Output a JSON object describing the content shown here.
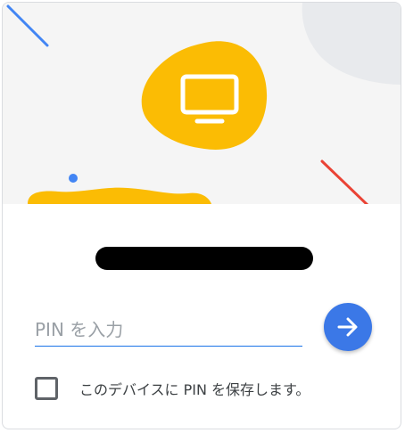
{
  "illustration": {
    "icon": "monitor-icon",
    "colors": {
      "background": "#f5f5f5",
      "blob": "#fbbc04",
      "corner_shape": "#e8eaed",
      "blue_accent": "#4285f4",
      "red_accent": "#ea4335",
      "icon_stroke": "#ffffff"
    }
  },
  "pin": {
    "placeholder": "PIN を入力",
    "value": ""
  },
  "submit": {
    "icon": "arrow-right-icon",
    "color": "#3b78e7"
  },
  "save_pin": {
    "label": "このデバイスに PIN を保存します。",
    "checked": false
  }
}
